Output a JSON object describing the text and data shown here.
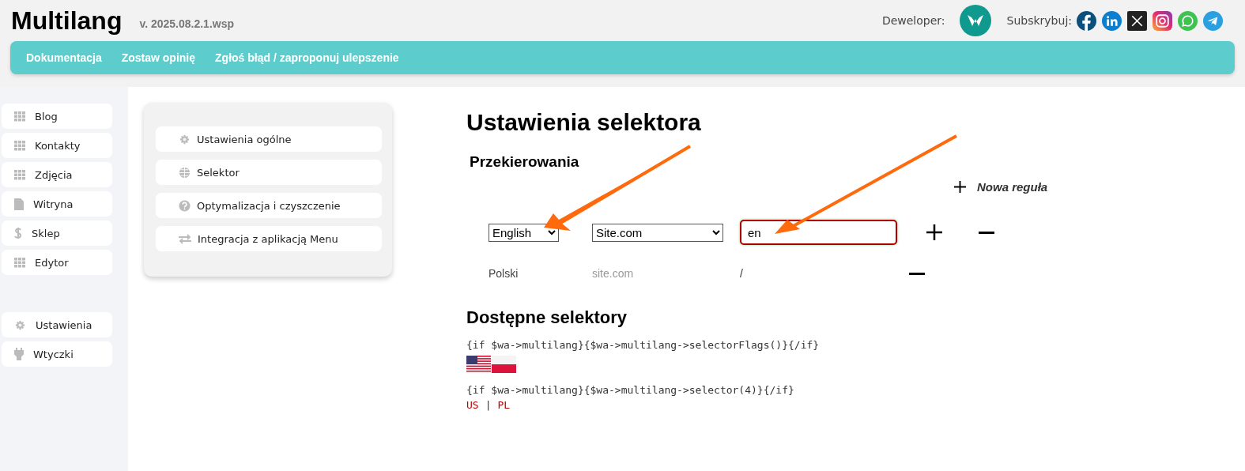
{
  "header": {
    "title": "Multilang",
    "version": "v. 2025.08.2.1.wsp",
    "developer_label": "Deweloper:",
    "subscribe_label": "Subskrybuj:"
  },
  "nav": [
    "Dokumentacja",
    "Zostaw opinię",
    "Zgłoś błąd / zaproponuj ulepszenie"
  ],
  "sidebar": {
    "items": [
      "Blog",
      "Kontakty",
      "Zdjęcia",
      "Witryna",
      "Sklep",
      "Edytor"
    ],
    "bottom_items": [
      "Ustawienia",
      "Wtyczki"
    ]
  },
  "settings_menu": [
    "Ustawienia ogólne",
    "Selektor",
    "Optymalizacja i czyszczenie",
    "Integracja z aplikacją Menu"
  ],
  "page": {
    "title": "Ustawienia selektora",
    "section": "Przekierowania",
    "new_rule": "Nowa reguła",
    "rules": [
      {
        "kind": "edit",
        "language": "English",
        "site": "Site.com",
        "path": "en"
      },
      {
        "kind": "static",
        "language": "Polski",
        "site": "site.com",
        "path": "/"
      }
    ],
    "selectors_title": "Dostępne selektory",
    "selectors": [
      {
        "kind": "flags",
        "code": "{if $wa->multilang}{$wa->multilang->selectorFlags()}{/if}"
      },
      {
        "kind": "links",
        "code": "{if $wa->multilang}{$wa->multilang->selector(4)}{/if}",
        "links": [
          "US",
          "PL"
        ],
        "separator": "|"
      }
    ]
  }
}
